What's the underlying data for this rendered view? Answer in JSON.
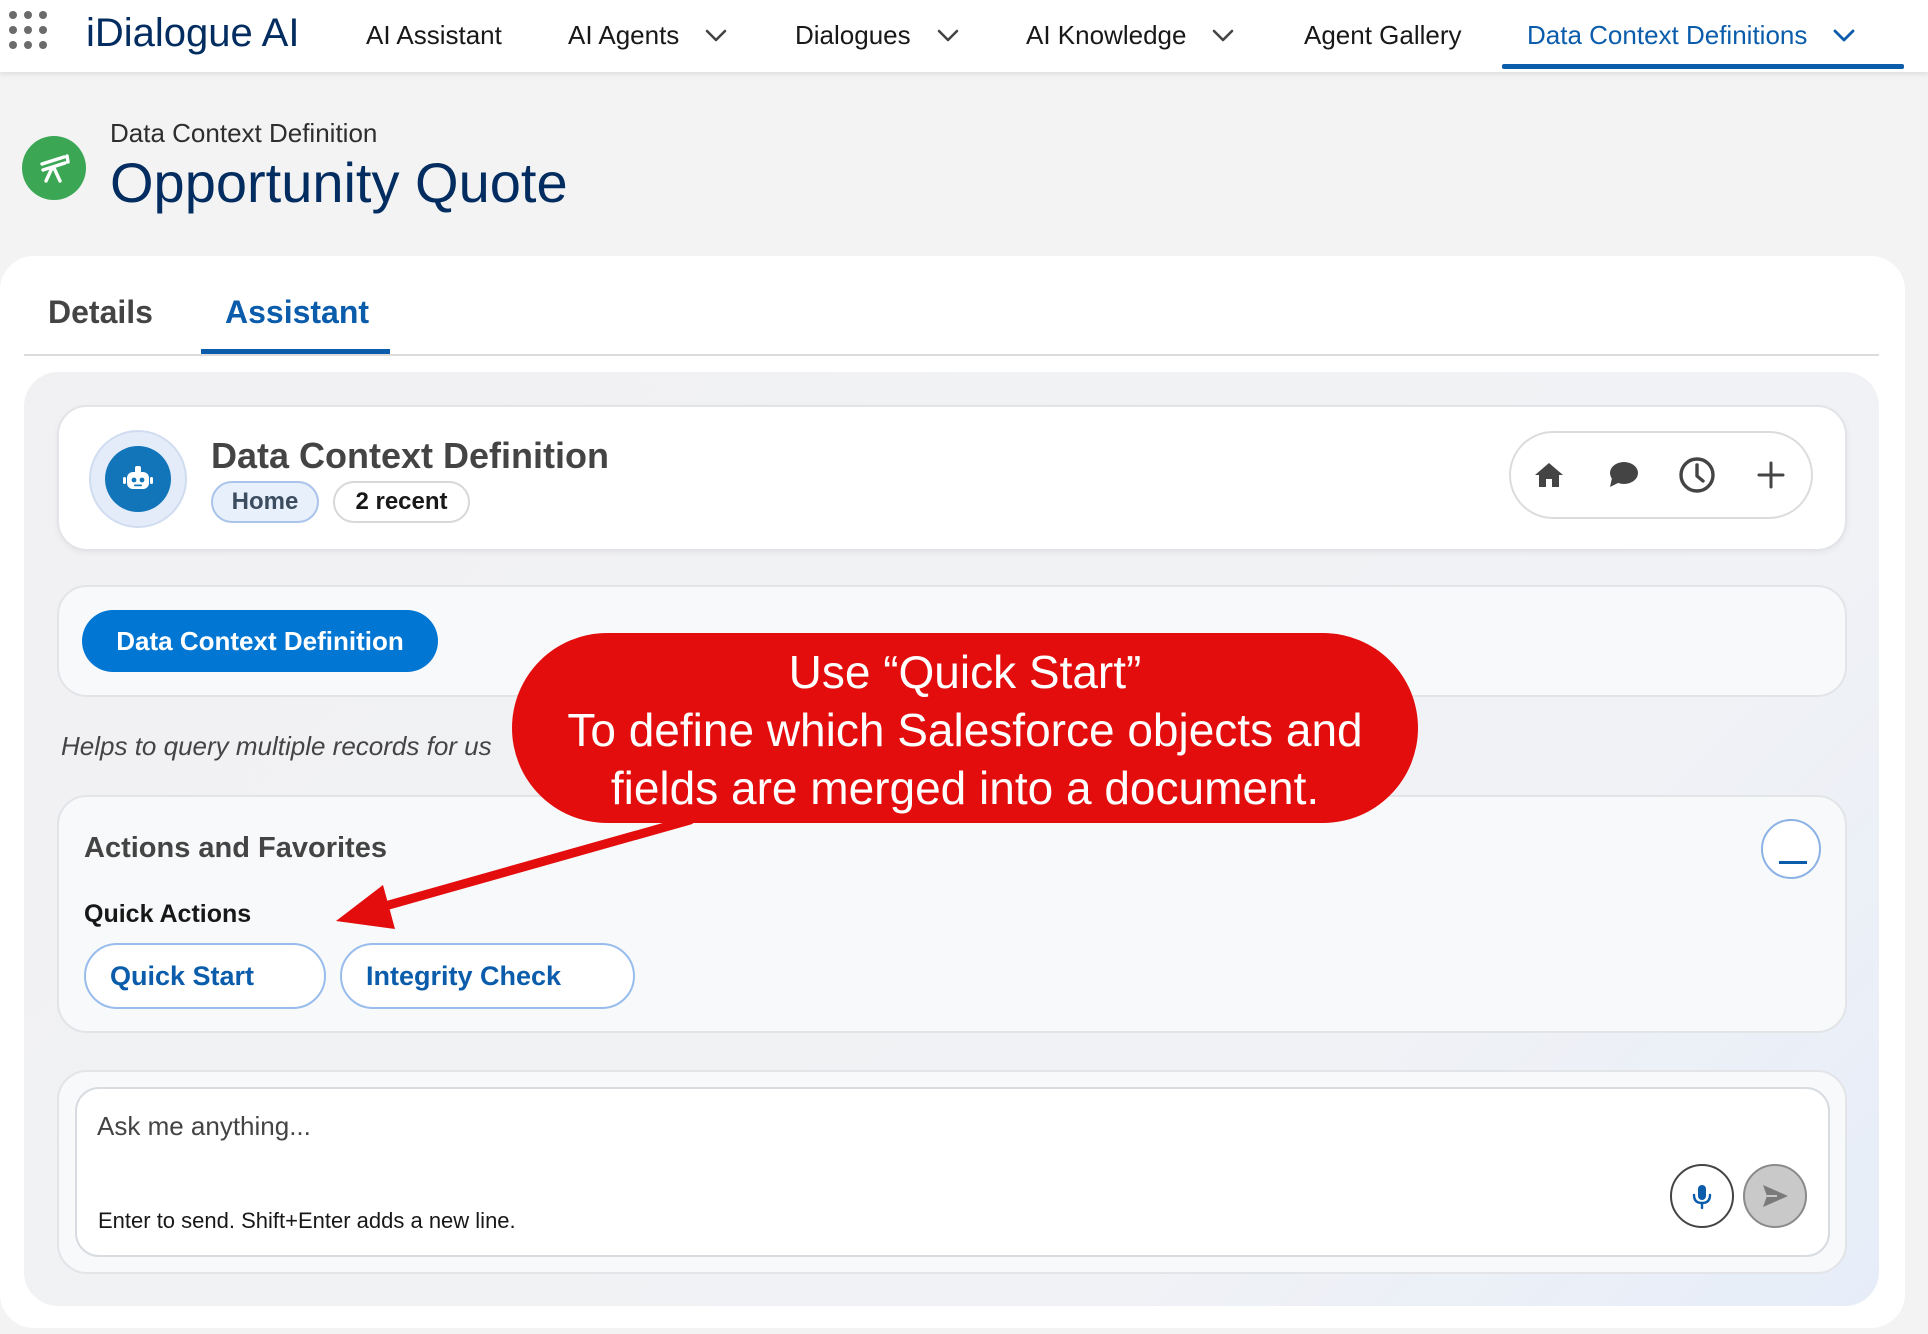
{
  "app": {
    "name": "iDialogue AI"
  },
  "nav": {
    "items": [
      {
        "label": "AI Assistant"
      },
      {
        "label": "AI Agents"
      },
      {
        "label": "Dialogues"
      },
      {
        "label": "AI Knowledge"
      },
      {
        "label": "Agent Gallery"
      },
      {
        "label": "Data Context Definitions"
      }
    ],
    "active": "Data Context Definitions"
  },
  "page": {
    "object_type": "Data Context Definition",
    "title": "Opportunity Quote",
    "icon": "telescope-icon",
    "icon_color": "#3ba755"
  },
  "tabs": {
    "items": [
      {
        "label": "Details"
      },
      {
        "label": "Assistant"
      }
    ],
    "active": "Assistant"
  },
  "assistant": {
    "title": "Data Context Definition",
    "pills": [
      {
        "label": "Home"
      },
      {
        "label": "2 recent"
      }
    ],
    "toolbar_icons": [
      "home-icon",
      "chat-icon",
      "history-icon",
      "plus-icon"
    ],
    "agent_button": "Data Context Definition",
    "helper_text": "Helps to query multiple records for us",
    "actions": {
      "title": "Actions and Favorites",
      "quick_actions_label": "Quick Actions",
      "buttons": [
        {
          "label": "Quick Start"
        },
        {
          "label": "Integrity Check"
        }
      ]
    },
    "composer": {
      "placeholder": "Ask me anything...",
      "hint": "Enter to send. Shift+Enter adds a new line."
    }
  },
  "callout": {
    "lines": [
      "Use “Quick Start”",
      "To define which Salesforce objects and",
      "fields are merged into a document."
    ],
    "color": "#e30d0d"
  },
  "colors": {
    "brand_dark": "#032d60",
    "accent": "#0b5cab",
    "primary_button": "#0176d3"
  }
}
